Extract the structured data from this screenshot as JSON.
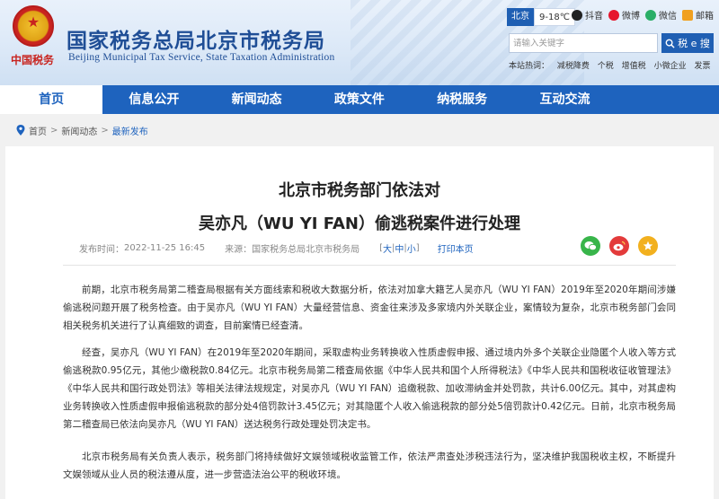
{
  "header": {
    "logo_text": "中国税务",
    "title": "国家税务总局北京市税务局",
    "subtitle": "Beijing Municipal Tax Service, State Taxation Administration",
    "weather_city": "北京",
    "weather_temp": "9-18℃",
    "social": [
      {
        "label": "抖音",
        "icon": "douyin-icon"
      },
      {
        "label": "微博",
        "icon": "weibo-icon"
      },
      {
        "label": "微信",
        "icon": "weixin-icon"
      },
      {
        "label": "邮箱",
        "icon": "mail-icon"
      }
    ],
    "search_placeholder": "请输入关键字",
    "search_label": "税 e 搜",
    "hot_words_label": "本站热词：",
    "hot_words": [
      "减税降费",
      "个税",
      "增值税",
      "小微企业",
      "发票"
    ]
  },
  "nav": {
    "items": [
      "首页",
      "信息公开",
      "新闻动态",
      "政策文件",
      "纳税服务",
      "互动交流"
    ],
    "active_index": 0
  },
  "breadcrumb": {
    "items": [
      "首页",
      "新闻动态",
      "最新发布"
    ],
    "separator": ">"
  },
  "article": {
    "title_line1": "北京市税务部门依法对",
    "title_line2": "吴亦凡（WU YI FAN）偷逃税案件进行处理",
    "publish_label": "发布时间：",
    "publish_time": "2022-11-25 16:45",
    "source_label": "来源：",
    "source": "国家税务总局北京市税务局",
    "font_bracket_open": "[",
    "font_large": "大",
    "font_medium": "中",
    "font_small": "小",
    "font_bracket_close": "]",
    "font_sep": "|",
    "print_label": "打印本页",
    "paragraphs": [
      "前期，北京市税务局第二稽查局根据有关方面线索和税收大数据分析，依法对加拿大籍艺人吴亦凡（WU YI FAN）2019年至2020年期间涉嫌偷逃税问题开展了税务检查。由于吴亦凡（WU YI FAN）大量经营信息、资金往来涉及多家境内外关联企业，案情较为复杂，北京市税务部门会同相关税务机关进行了认真细致的调查，目前案情已经查清。",
      "经查，吴亦凡（WU YI FAN）在2019年至2020年期间，采取虚构业务转换收入性质虚假申报、通过境内外多个关联企业隐匿个人收入等方式偷逃税款0.95亿元，其他少缴税款0.84亿元。北京市税务局第二稽查局依据《中华人民共和国个人所得税法》《中华人民共和国税收征收管理法》《中华人民共和国行政处罚法》等相关法律法规规定，对吴亦凡（WU YI FAN）追缴税款、加收滞纳金并处罚款，共计6.00亿元。其中，对其虚构业务转换收入性质虚假申报偷逃税款的部分处4倍罚款计3.45亿元；对其隐匿个人收入偷逃税款的部分处5倍罚款计0.42亿元。日前，北京市税务局第二稽查局已依法向吴亦凡（WU YI FAN）送达税务行政处理处罚决定书。",
      "北京市税务局有关负责人表示，税务部门将持续做好文娱领域税收监管工作，依法严肃查处涉税违法行为，坚决维护我国税收主权，不断提升文娱领域从业人员的税法遵从度，进一步营造法治公平的税收环境。"
    ]
  },
  "colors": {
    "brand_blue": "#1e63be",
    "title_blue": "#1f4e96",
    "emblem_red": "#c8241f"
  }
}
